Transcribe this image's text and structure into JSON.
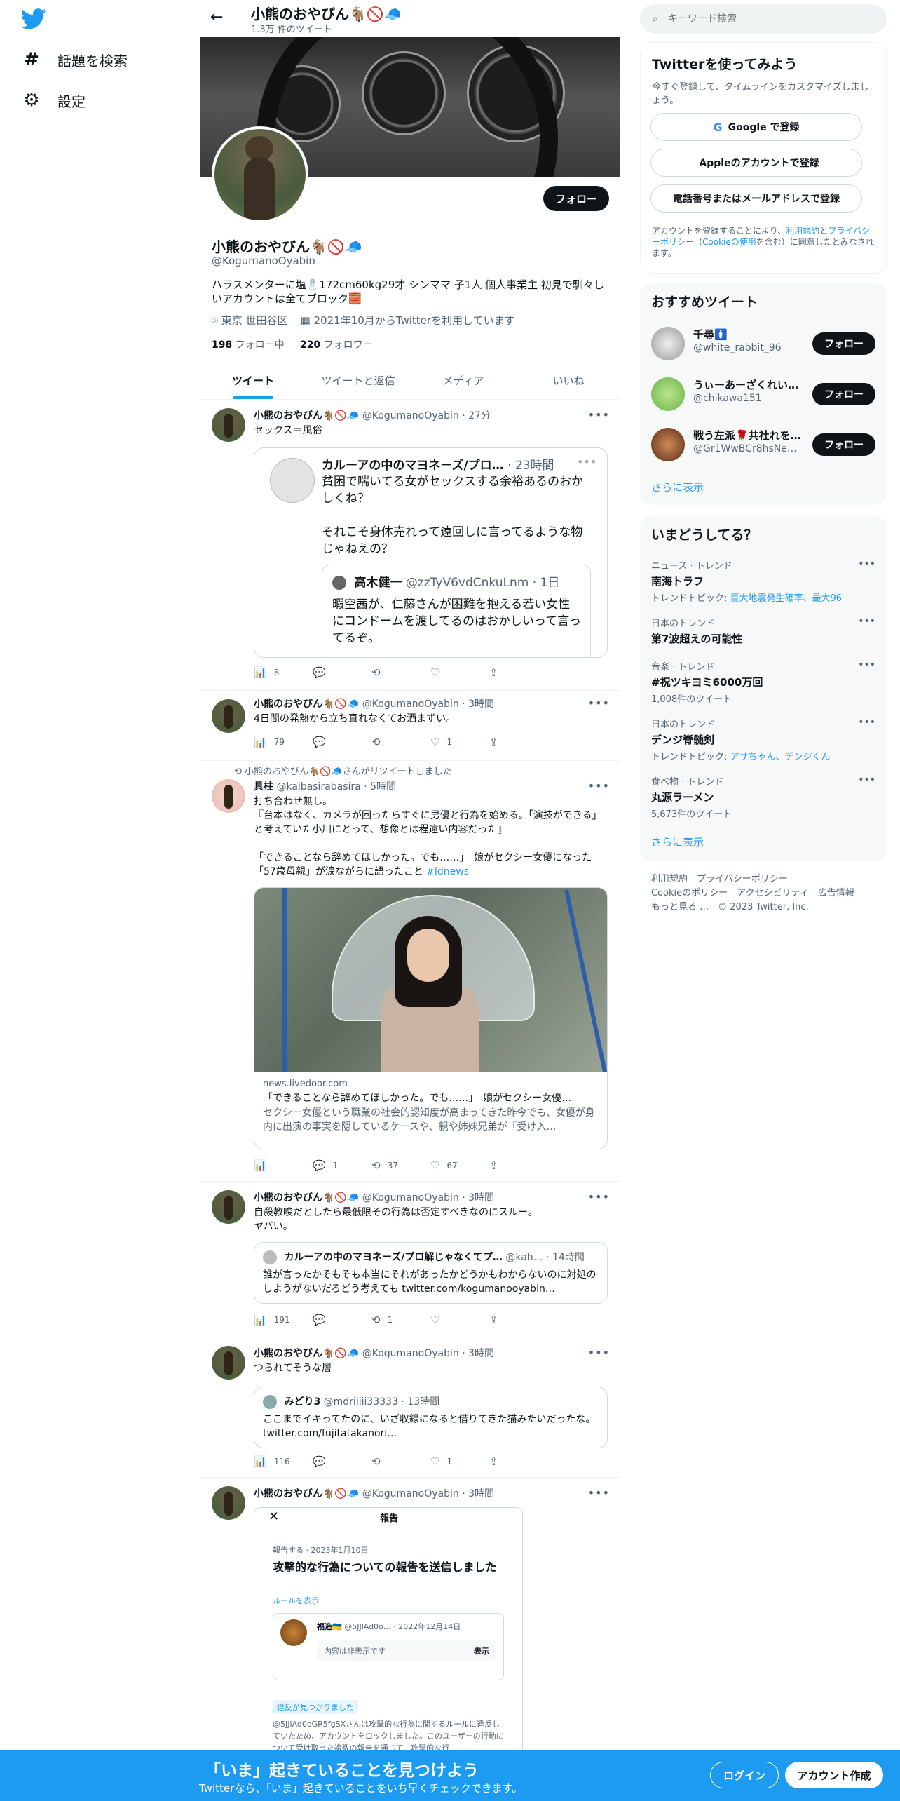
{
  "profile": {
    "name": "小熊のおやびん🐐🚫🧢",
    "tweet_count": "1.3万 件のツイート",
    "handle": "@KogumanoOyabin",
    "bio": "ハラスメンターに塩🧂172cm60kg29才 シンママ 子1人 個人事業主 初見で馴々しいアカウントは全てブロック🧱",
    "location": "東京 世田谷区",
    "joined": "2021年10月からTwitterを利用しています",
    "following_num": "198",
    "following_label": "フォロー中",
    "followers_num": "220",
    "followers_label": "フォロワー",
    "follow_label": "フォロー"
  },
  "nav": {
    "explore": "話題を検索",
    "settings": "設定"
  },
  "tabs": [
    "ツイート",
    "ツイートと返信",
    "メディア",
    "いいね"
  ],
  "tweets": [
    {
      "name": "小熊のおやびん🐐🚫🧢",
      "handle": "@KogumanoOyabin",
      "time": "27分",
      "text": "セックス＝風俗",
      "quote": {
        "name": "カルーアの中のマヨネーズ/プロ…",
        "time": "23時間",
        "text": "貧困で喘いてる女がセックスする余裕あるのおかしくね？\n\nそれこそ身体売れって遠回しに言ってるような物じゃねえの？",
        "inner": {
          "name": "高木健一",
          "handle": "@zzTyV6vdCnkuLnm",
          "time": "1日",
          "text": "暇空茜が、仁藤さんが困難を抱える若い女性にコンドームを渡してるのはおかしいって言ってるぞ。"
        }
      },
      "views": "8",
      "replies": "",
      "retweets": "",
      "likes": ""
    },
    {
      "name": "小熊のおやびん🐐🚫🧢",
      "handle": "@KogumanoOyabin",
      "time": "3時間",
      "text": "4日間の発熱から立ち直れなくてお酒まずい。",
      "views": "79",
      "replies": "",
      "retweets": "",
      "likes": "1"
    },
    {
      "retweeted_by": "小熊のおやびん🐐🚫🧢さんがリツイートしました",
      "name": "具柱",
      "handle": "@kaibasirabasira",
      "time": "5時間",
      "text": "打ち合わせ無し。\n『台本はなく、カメラが回ったらすぐに男優と行為を始める。「演技ができる」と考えていた小川にとって、想像とは程遠い内容だった』\n\n「できることなら辞めてほしかった。でも……」　娘がセクシー女優になった「57歳母親」が涙ながらに語ったこと",
      "hashtag": "#ldnews",
      "link": {
        "domain": "news.livedoor.com",
        "title": "「できることなら辞めてほしかった。でも……」　娘がセクシー女優…",
        "desc": "セクシー女優という職業の社会的認知度が高まってきた昨今でも、女優が身内に出演の事実を隠しているケースや、親や姉妹兄弟が「受け入…"
      },
      "views": "",
      "replies": "1",
      "retweets": "37",
      "likes": "67"
    },
    {
      "name": "小熊のおやびん🐐🚫🧢",
      "handle": "@KogumanoOyabin",
      "time": "3時間",
      "text": "自殺教唆だとしたら最低限その行為は否定すべきなのにスルー。\nヤバい。",
      "quote": {
        "name": "カルーアの中のマヨネーズ/プロ解じゃなくてプ…",
        "handle": "@kah…",
        "time": "14時間",
        "text": "誰が言ったかそもそも本当にそれがあったかどうかもわからないのに対処のしようがないだろどう考えても twitter.com/kogumanooyabin…"
      },
      "views": "191",
      "replies": "",
      "retweets": "1",
      "likes": ""
    },
    {
      "name": "小熊のおやびん🐐🚫🧢",
      "handle": "@KogumanoOyabin",
      "time": "3時間",
      "text": "つられてそうな層",
      "quote": {
        "name": "みどり3",
        "handle": "@mdriiiii33333",
        "time": "13時間",
        "text": "ここまでイキってたのに、いざ収録になると借りてきた猫みたいだったな。 twitter.com/fujitatakanori…"
      },
      "views": "116",
      "replies": "",
      "retweets": "",
      "likes": "1"
    },
    {
      "name": "小熊のおやびん🐐🚫🧢",
      "handle": "@KogumanoOyabin",
      "time": "3時間",
      "report": {
        "header": "報告",
        "crumb": "報告する · 2023年1月10日",
        "title": "攻撃的な行為についての報告を送信しました",
        "rules": "ルールを表示",
        "reported_name": "福造🇺🇦",
        "reported_handle": "@5JJlAd0o…",
        "reported_time": "2022年12月14日",
        "hidden": "内容は非表示です",
        "show": "表示",
        "badge": "違反が見つかりました",
        "result": "@5JJlAd0oGR5fgSXさんは攻撃的な行為に関するルールに違反していたため、アカウントをロックしました。このユーザーの行動について受け取った複数の報告を通じて、攻撃的な行"
      }
    }
  ],
  "right": {
    "search_placeholder": "キーワード検索",
    "signup": {
      "title": "Twitterを使ってみよう",
      "sub": "今すぐ登録して、タイムラインをカスタマイズしましょう。",
      "google": "Google で登録",
      "apple": "Appleのアカウントで登録",
      "phone": "電話番号またはメールアドレスで登録",
      "terms_a": "アカウントを登録することにより、",
      "terms_link1": "利用規約",
      "terms_b": "と",
      "terms_link2": "プライバシーポリシー",
      "terms_c": "（",
      "terms_link3": "Cookieの使用",
      "terms_d": "を含む）に同意したとみなされます。"
    },
    "recommend": {
      "title": "おすすめツイート",
      "items": [
        {
          "name": "千尋🚺",
          "handle": "@white_rabbit_96",
          "btn": "フォロー"
        },
        {
          "name": "うぃーあーざくれい…",
          "handle": "@chikawa151",
          "btn": "フォロー"
        },
        {
          "name": "戦う左派🌹共社れを…",
          "handle": "@Gr1WwBCr8hsNe…",
          "btn": "フォロー"
        }
      ],
      "more": "さらに表示"
    },
    "trends": {
      "title": "いまどうしてる？",
      "items": [
        {
          "cat": "ニュース · トレンド",
          "title": "南海トラフ",
          "sub": "トレンドトピック: ",
          "sub_link": "巨大地震発生確率、最大96"
        },
        {
          "cat": "日本のトレンド",
          "title": "第7波超えの可能性",
          "sub": "",
          "sub_link": ""
        },
        {
          "cat": "音楽 · トレンド",
          "title": "#祝ツキヨミ6000万回",
          "sub": "1,008件のツイート",
          "sub_link": ""
        },
        {
          "cat": "日本のトレンド",
          "title": "デンジ脊髄剣",
          "sub": "トレンドトピック: ",
          "sub_link": "アサちゃん、デンジくん"
        },
        {
          "cat": "食べ物 · トレンド",
          "title": "丸源ラーメン",
          "sub": "5,673件のツイート",
          "sub_link": ""
        }
      ],
      "more": "さらに表示"
    },
    "footer": {
      "l1": "利用規約　プライバシーポリシー",
      "l2": "Cookieのポリシー　アクセシビリティ　広告情報",
      "l3": "もっと見る …　© 2023 Twitter, Inc."
    }
  },
  "bottom": {
    "title": "「いま」起きていることを見つけよう",
    "sub": "Twitterなら、「いま」起きていることをいち早くチェックできます。",
    "login": "ログイン",
    "signup": "アカウント作成"
  },
  "colors": {
    "accent": "#1d9bf0",
    "text": "#0f1419",
    "muted": "#536471",
    "border": "#eff3f4"
  }
}
